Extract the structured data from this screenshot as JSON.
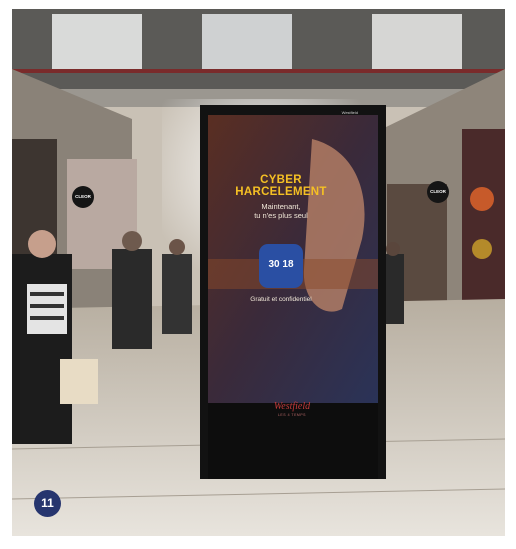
{
  "screen": {
    "headline_line1": "CYBER",
    "headline_line2": "HARCELEMENT",
    "subline_line1": "Maintenant,",
    "subline_line2": "tu n'es plus seul",
    "badge_number": "30 18",
    "footline": "Gratuit et confidentiel",
    "corner_label": "Westfield"
  },
  "kiosk": {
    "brand": "Westfield",
    "brand_sub": "LES 4 TEMPS"
  },
  "store_signs": [
    "CLEOR",
    "CLEOR"
  ],
  "figure_number": "11",
  "colors": {
    "headline": "#f5c024",
    "badge": "#2a4fa3",
    "number_tag": "#26356e",
    "brand": "#c03a3a"
  }
}
